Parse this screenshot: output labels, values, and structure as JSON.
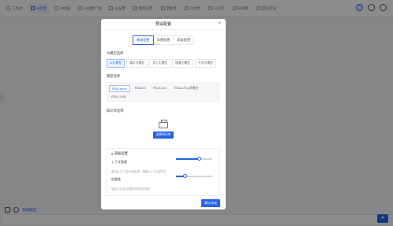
{
  "nav": {
    "items": [
      {
        "label": "工作台",
        "active": false
      },
      {
        "label": "AI对话",
        "active": true
      },
      {
        "label": "AI绘画",
        "active": false
      },
      {
        "label": "AI创意广场",
        "active": false
      },
      {
        "label": "AI应用",
        "active": false
      },
      {
        "label": "我的应用",
        "active": false
      },
      {
        "label": "智能体",
        "active": false
      },
      {
        "label": "AI文件",
        "active": false
      },
      {
        "label": "AI写作",
        "active": false
      },
      {
        "label": "知识库",
        "active": false
      },
      {
        "label": "团队空间",
        "active": false
      }
    ]
  },
  "bottom": {
    "other_model_label": "其他模型",
    "send_icon": "send-icon"
  },
  "modal": {
    "title": "预设配置",
    "close": "×",
    "tabs": [
      "基础配置",
      "场景配置",
      "高级配置"
    ],
    "model_section_title": "大模型选择",
    "models": [
      "AI大模型",
      "通义大模型",
      "文心大模型",
      "智谱大模型",
      "千问大模型"
    ],
    "active_model_index": 0,
    "submodel_section_title": "模型选择",
    "submodels": [
      "RSAI-turbo",
      "RSAI4.0",
      "RSAI-3in1",
      "RSAI4-Plus多模态",
      "RSAI-128K"
    ],
    "active_submodel_index": 0,
    "kb_section_title": "知识库选择",
    "kb_button": "选择知识库",
    "advanced": {
      "title": "高级设置",
      "context_label": "上下文数量",
      "context_desc": "要包含上下文的对话轮数，值越大上下文越丰富",
      "context_value": 0.65,
      "temp_label": "创意度",
      "temp_desc": "值越大生成内容越多样和具创造性",
      "temp_value": 0.25
    },
    "confirm": "确认完成"
  },
  "colors": {
    "accent": "#2563eb",
    "overlay": "rgba(0,0,0,0.45)"
  }
}
